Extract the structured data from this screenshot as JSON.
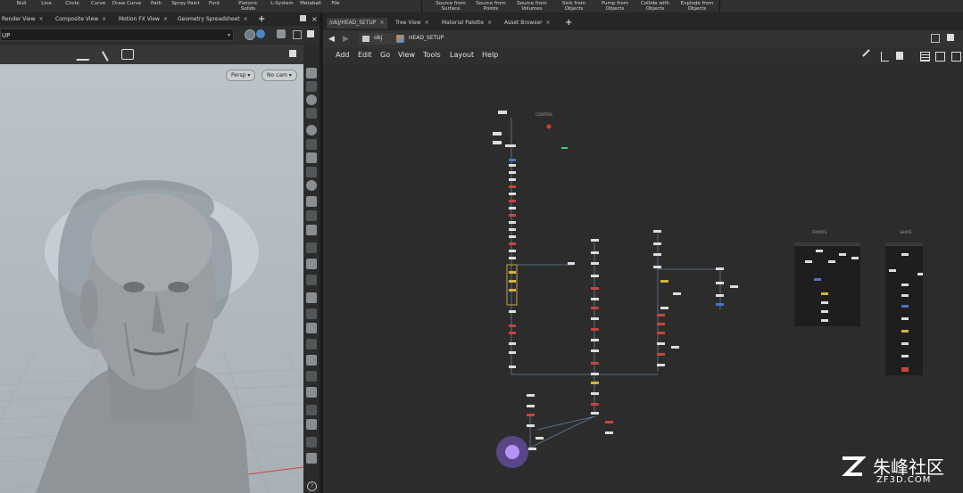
{
  "shelf": {
    "left_tools": [
      {
        "label": "Null"
      },
      {
        "label": "Line"
      },
      {
        "label": "Circle"
      },
      {
        "label": "Curve"
      },
      {
        "label": "Draw Curve"
      },
      {
        "label": "Path"
      },
      {
        "label": "Spray Paint"
      },
      {
        "label": "Font"
      },
      {
        "label": "Platonic Solids"
      },
      {
        "label": "L-System"
      },
      {
        "label": "Metaball"
      },
      {
        "label": "File"
      }
    ],
    "right_tools": [
      {
        "label": "Source from Surface"
      },
      {
        "label": "Source from Points"
      },
      {
        "label": "Source from Volumes"
      },
      {
        "label": "Sink from Objects"
      },
      {
        "label": "Pump from Objects"
      },
      {
        "label": "Collide with Objects"
      },
      {
        "label": "Explode from Objects"
      }
    ]
  },
  "left_pane": {
    "tabs": [
      {
        "label": "Render View"
      },
      {
        "label": "Composite View"
      },
      {
        "label": "Motion FX View"
      },
      {
        "label": "Geometry Spreadsheet"
      }
    ],
    "path_value": "UP",
    "viewport": {
      "persp_label": "Persp",
      "cam_label": "No cam"
    }
  },
  "right_pane": {
    "tabs": [
      {
        "label": "/obj/HEAD_SETUP"
      },
      {
        "label": "Tree View"
      },
      {
        "label": "Material Palette"
      },
      {
        "label": "Asset Browser"
      }
    ],
    "path": {
      "root": "obj",
      "current": "HEAD_SETUP"
    },
    "menu": [
      {
        "label": "Add"
      },
      {
        "label": "Edit"
      },
      {
        "label": "Go"
      },
      {
        "label": "View"
      },
      {
        "label": "Tools"
      },
      {
        "label": "Layout"
      },
      {
        "label": "Help"
      }
    ],
    "network": {
      "sticky_labels": [
        "CONTROL",
        "FRONTS",
        "SHAPE"
      ]
    }
  },
  "watermark": {
    "brand": "朱峰社区",
    "url": "ZF3D.COM"
  }
}
